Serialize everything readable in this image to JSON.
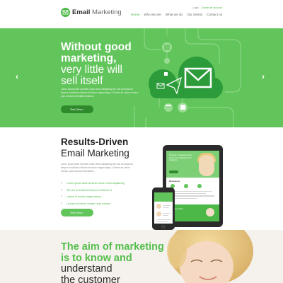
{
  "brand": {
    "name_bold": "Email",
    "name_light": " Marketing",
    "accent": "#4cb848"
  },
  "toplinks": {
    "login": "Login",
    "register": "Create an account"
  },
  "nav": {
    "items": [
      {
        "label": "Home"
      },
      {
        "label": "Who we are"
      },
      {
        "label": "What we do"
      },
      {
        "label": "Our clients"
      },
      {
        "label": "Contact us"
      }
    ]
  },
  "hero": {
    "title_line1": "Without good",
    "title_line2": "marketing,",
    "title_line3": "very little will",
    "title_line4": "sell itself",
    "text": "Lorem ipsum dolor sit amet conse ctetur adipisicing elit, sed do eiusmod tempor incididunt ut labore et dolore magna aliqua. Ut enim ad minim veniam, quis nostrud exercitation ullamco.",
    "button": "Test Drive",
    "prev": "‹",
    "next": "›"
  },
  "results": {
    "title_line1": "Results-Driven",
    "title_line2": "Email Marketing",
    "text": "Lorem ipsum dolor sit amet conse ctetur adipisicing elit, sed do eiusmod tempor incididunt ut labore et dolore magna aliqua. Ut enim ad minim veniam, quis nostrud exercitation.",
    "list": [
      "Lorem ipsum dolor sit amet conse ctetur adipisicing",
      "Elit sed do eiusmod tempor incididunt ut",
      "Labore et dolore magna aliqua",
      "Ut enim ad minim veniam, quis nostrud"
    ],
    "button": "Test Drive"
  },
  "tablet": {
    "hero_title": "The aim of marketing is to know and understand the customer",
    "resources": "Resources",
    "band_title": "Test Drive Day"
  },
  "aim": {
    "line1": "The aim of marketing",
    "line2": "is to know and",
    "line3": "understand",
    "line4": "the customer"
  }
}
